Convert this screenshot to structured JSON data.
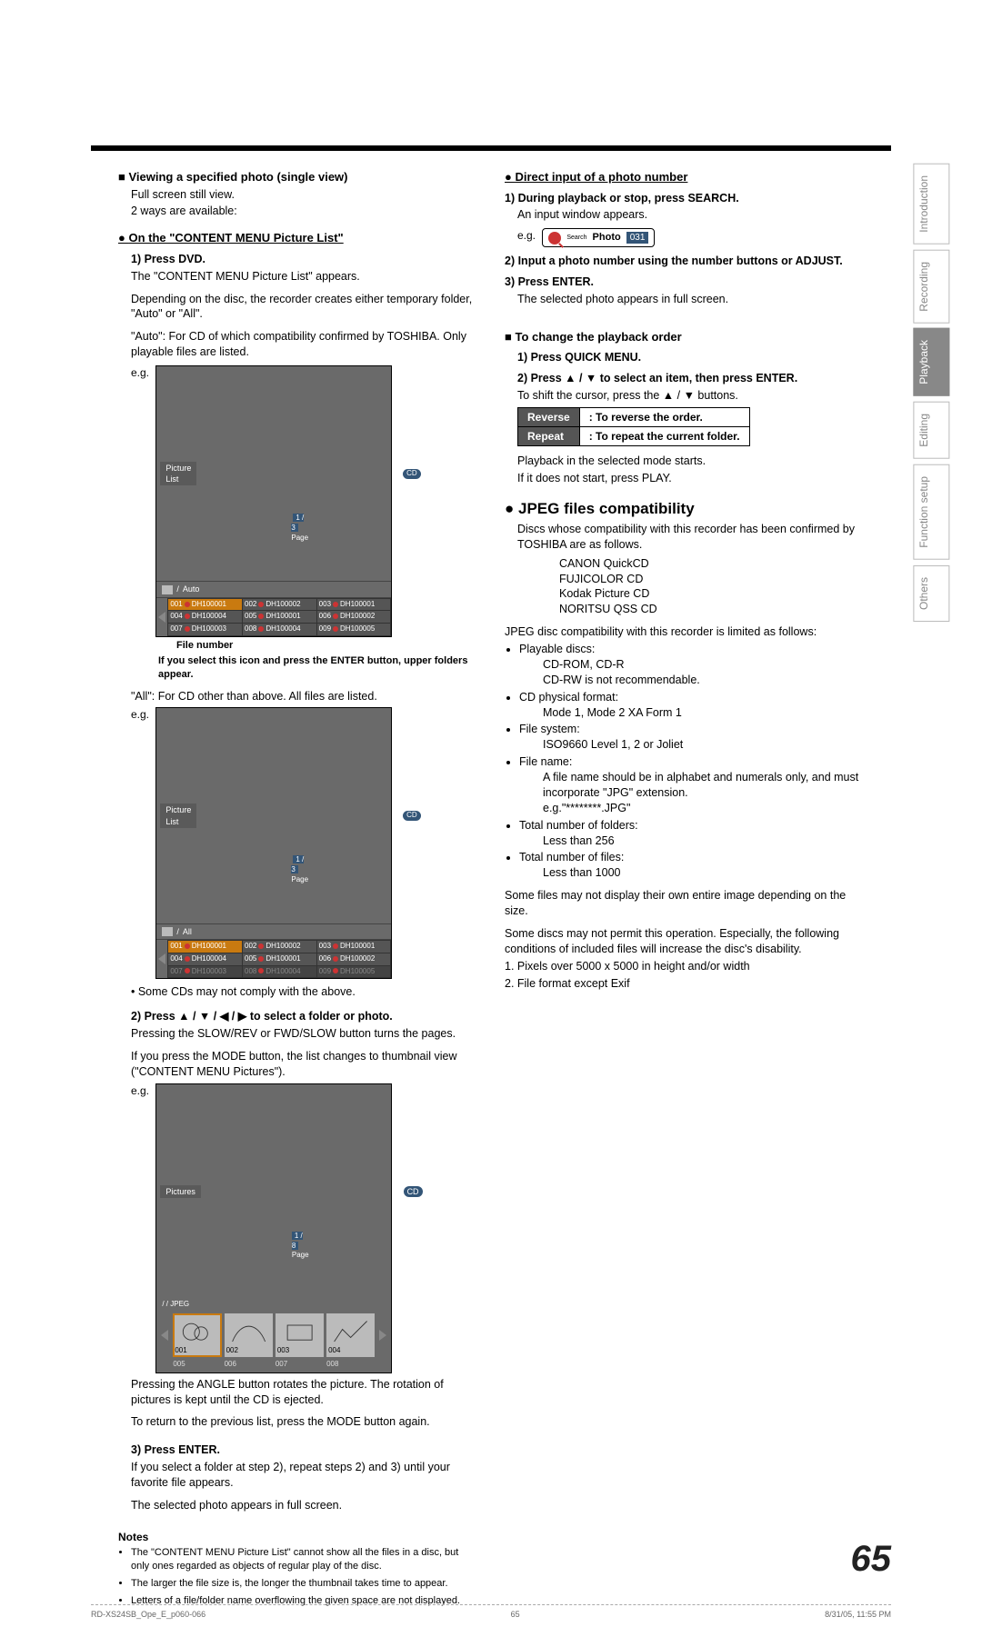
{
  "page_number": "65",
  "side_tabs": [
    "Introduction",
    "Recording",
    "Playback",
    "Editing",
    "Function setup",
    "Others"
  ],
  "side_tab_active_index": 2,
  "left": {
    "h1": "Viewing a specified photo (single view)",
    "h1_sub1": "Full screen still view.",
    "h1_sub2": "2 ways are available:",
    "bullet1": " On the \"CONTENT MENU Picture List\"",
    "s1": "1) Press DVD.",
    "s1b": "The \"CONTENT MENU Picture List\" appears.",
    "s1c": "Depending on the disc, the recorder creates either temporary folder, \"Auto\" or \"All\".",
    "s1d": "\"Auto\": For CD of which compatibility confirmed by TOSHIBA. Only playable files are listed.",
    "eg": "e.g.",
    "piclist_title": "Picture List",
    "piclist_page": "Page",
    "piclist_page_val": "1 / 3",
    "piclist_cd": "CD",
    "piclist_folder_auto": "Auto",
    "piclist_folder_all": "All",
    "piclist_rows_auto": [
      [
        "001",
        "DH100001",
        "002",
        "DH100002",
        "003",
        "DH100001"
      ],
      [
        "004",
        "DH100004",
        "005",
        "DH100001",
        "006",
        "DH100002"
      ],
      [
        "007",
        "DH100003",
        "008",
        "DH100004",
        "009",
        "DH100005"
      ]
    ],
    "piclist_rows_all": [
      [
        "001",
        "DH100001",
        "002",
        "DH100002",
        "003",
        "DH100001"
      ],
      [
        "004",
        "DH100004",
        "005",
        "DH100001",
        "006",
        "DH100002"
      ],
      [
        "007",
        "DH100003",
        "008",
        "DH100004",
        "009",
        "DH100005"
      ]
    ],
    "cap_file_number": "File number",
    "cap_select_icon": "If you select this icon and press the ENTER button, upper folders appear.",
    "s1e": "\"All\":   For CD other than above. All files are listed.",
    "s1f": "• Some CDs may not comply with the above.",
    "s2": "2) Press ▲ / ▼ / ◀ / ▶ to select a folder or photo.",
    "s2b": "Pressing the SLOW/REV or FWD/SLOW button turns the pages.",
    "s2c": "If you press the MODE button, the list changes to thumbnail view (\"CONTENT MENU Pictures\").",
    "thumb_title": "Pictures",
    "thumb_sub": "JPEG",
    "thumb_page": "1 / 8",
    "thumb_nums": [
      "001",
      "002",
      "003",
      "004"
    ],
    "thumb_nums2": [
      "005",
      "006",
      "007",
      "008"
    ],
    "s2d": "Pressing the ANGLE button rotates the picture. The rotation of pictures is kept until the CD is ejected.",
    "s2e": "To return to the previous list, press the MODE button again.",
    "s3": "3) Press ENTER.",
    "s3b": "If you select a folder at step 2), repeat steps 2) and 3) until your favorite file appears.",
    "s3c": "The selected photo appears in full screen.",
    "notes_h": "Notes",
    "notes": [
      "The \"CONTENT MENU Picture List\" cannot show all the files in a disc, but only ones regarded as objects of regular play of the disc.",
      "The larger the file size is, the longer the thumbnail takes time to appear.",
      "Letters of a file/folder name overflowing the given space are not displayed."
    ]
  },
  "right": {
    "bullet1": " Direct input of a photo number",
    "s1": "1) During playback or stop, press SEARCH.",
    "s1b": "An input window appears.",
    "search_label_search": "Search",
    "search_label_photo": "Photo",
    "search_val": "031",
    "s2": "2) Input a photo number using the number buttons or ADJUST.",
    "s3": "3) Press ENTER.",
    "s3b": "The selected photo appears in full screen.",
    "h2": "To change the playback order",
    "p1": "1) Press QUICK MENU.",
    "p2": "2) Press ▲ / ▼ to select an item, then press ENTER.",
    "p2b": "To shift the cursor, press the ▲ / ▼ buttons.",
    "mode_reverse": "Reverse",
    "mode_reverse_desc": ": To reverse the order.",
    "mode_repeat": "Repeat",
    "mode_repeat_desc": ": To repeat the current folder.",
    "p2c": "Playback in the selected mode starts.",
    "p2d": "If it does not start, press PLAY.",
    "compat_h": "JPEG files compatibility",
    "c1": "Discs whose compatibility with this recorder has been confirmed by TOSHIBA are as follows.",
    "c_list": [
      "CANON QuickCD",
      "FUJICOLOR CD",
      "Kodak Picture CD",
      "NORITSU QSS CD"
    ],
    "c2": "JPEG disc compatibility with this recorder is limited as follows:",
    "specs": [
      {
        "k": "Playable discs:",
        "v": [
          "CD-ROM, CD-R",
          "CD-RW is not recommendable."
        ]
      },
      {
        "k": "CD physical format:",
        "v": [
          "Mode 1, Mode 2 XA Form 1"
        ]
      },
      {
        "k": "File system:",
        "v": [
          "ISO9660 Level 1, 2 or Joliet"
        ]
      },
      {
        "k": "File name:",
        "v": [
          "A file name should be in alphabet and numerals only, and must incorporate \"JPG\" extension.",
          "e.g.\"********.JPG\""
        ]
      },
      {
        "k": "Total number of folders:",
        "v": [
          "Less than 256"
        ]
      },
      {
        "k": "Total number of files:",
        "v": [
          "Less than 1000"
        ]
      }
    ],
    "c3": "Some files may not display their own entire image depending on the size.",
    "c4": "Some discs may not permit this operation. Especially, the following conditions of included files will increase the disc's disability.",
    "c5": "1. Pixels over 5000 x 5000 in height and/or width",
    "c6": "2. File format except Exif"
  },
  "footer": {
    "left": "RD-XS24SB_Ope_E_p060-066",
    "mid": "65",
    "right": "8/31/05, 11:55 PM"
  }
}
